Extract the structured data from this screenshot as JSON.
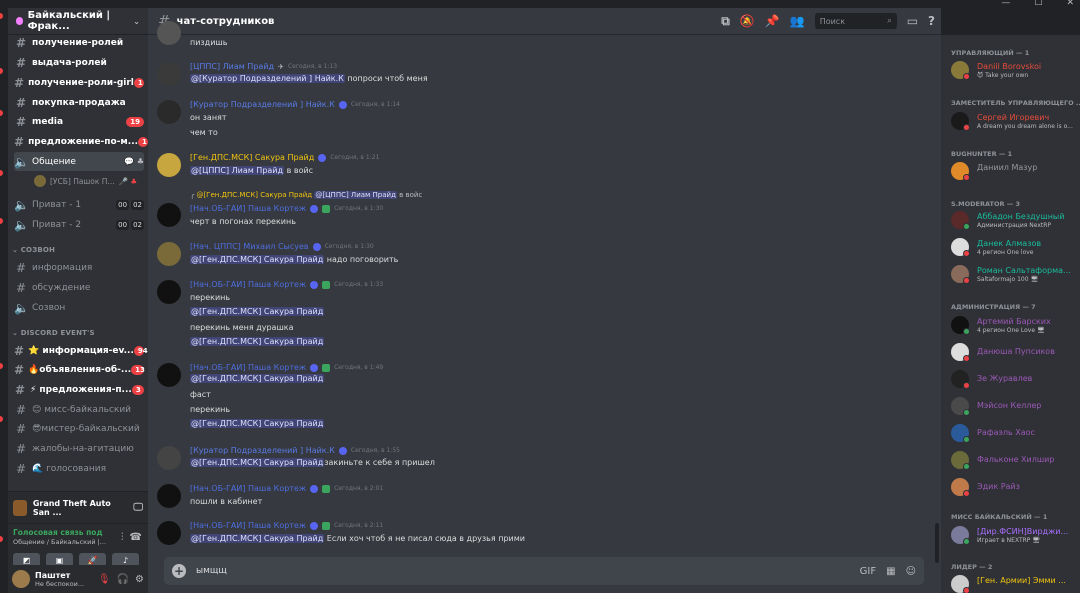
{
  "window": {
    "minimize": "—",
    "maximize": "☐",
    "close": "✕"
  },
  "server": {
    "name": "Байкальский | Фрак..."
  },
  "channels": [
    {
      "name": "получение-ролей",
      "unread": true,
      "badge": ""
    },
    {
      "name": "выдача-ролей",
      "unread": true,
      "badge": ""
    },
    {
      "name": "получение-роли-girl",
      "unread": true,
      "badge": "1"
    },
    {
      "name": "покупка-продажа",
      "unread": true,
      "badge": ""
    },
    {
      "name": "media",
      "unread": true,
      "badge": "19"
    },
    {
      "name": "предложение-по-м...",
      "unread": true,
      "badge": "1"
    }
  ],
  "voice_channels": [
    {
      "name": "Общение",
      "icons": "💬 ♣"
    },
    {
      "name": "Приват - 1",
      "c1": "00",
      "c2": "02"
    },
    {
      "name": "Приват - 2",
      "c1": "00",
      "c2": "02"
    }
  ],
  "voice_user": {
    "name": "[УСБ] Пашок П...",
    "icons": "🎤 ♣"
  },
  "category_1": "СОЗВОН",
  "channels_2": [
    {
      "name": "информация"
    },
    {
      "name": "обсуждение"
    }
  ],
  "voice_2": {
    "name": "Созвон"
  },
  "category_2": "DISCORD EVENT'S",
  "channels_3": [
    {
      "name": "⭐ информация-ev...",
      "badge": "94",
      "unread": true
    },
    {
      "name": "🔥объявления-об-...",
      "badge": "13",
      "unread": true
    },
    {
      "name": "⚡ предложения-п...",
      "badge": "3",
      "unread": true
    },
    {
      "name": "😊 мисс-байкальский",
      "badge": "",
      "unread": false
    },
    {
      "name": "😎мистер-байкальский",
      "badge": "",
      "unread": false
    },
    {
      "name": "жалобы-на-агитацию",
      "badge": "",
      "unread": false
    },
    {
      "name": "🌊 голосования",
      "badge": "",
      "unread": false
    }
  ],
  "activity": {
    "game": "Grand Theft Auto San ..."
  },
  "voice_status": {
    "title": "Голосовая связь под",
    "sub": "Общение / Байкальский |..."
  },
  "user": {
    "name": "Паштет",
    "status": "Не беспокои..."
  },
  "header": {
    "channel": "чат-сотрудников",
    "search_placeholder": "Поиск"
  },
  "messages": [
    {
      "lines": [
        "пиздишь"
      ]
    },
    {
      "author": "[ЦППС] Лиам Прайд",
      "time": "Сегодня, в 1:13",
      "mention": "@[Куратор Подразделений ] Найк.К",
      "text": "попроси чтоб меня"
    },
    {
      "author": "[Куратор Подразделений ] Найк.К",
      "time": "Сегодня, в 1:14",
      "lines": [
        "он занят",
        "чем то"
      ]
    },
    {
      "author": "[Ген.ДПС.МСК] Сакура Прайд",
      "time": "Сегодня, в 1:21",
      "mention": "@[ЦППС] Лиам Прайд",
      "text": "в войс"
    },
    {
      "reply": "@[Ген.ДПС.МСК] Сакура Прайд",
      "reply_mention": "@[ЦППС] Лиам Прайд",
      "reply_text": "в войс",
      "author": "[Нач.ОБ-ГАИ] Паша Кортеж",
      "time": "Сегодня, в 1:30",
      "lines": [
        "черт в погонах перекинь"
      ]
    },
    {
      "author": "[Нач. ЦППС] Михаил Сысуев",
      "time": "Сегодня, в 1:30",
      "mention": "@[Ген.ДПС.МСК] Сакура Прайд",
      "text": "надо поговорить"
    },
    {
      "author": "[Нач.ОБ-ГАИ] Паша Кортеж",
      "time": "Сегодня, в 1:33",
      "lines": [
        "перекинь",
        "@[Ген.ДПС.МСК] Сакура Прайд",
        "перекинь меня дурашка",
        "@[Ген.ДПС.МСК] Сакура Прайд"
      ]
    },
    {
      "author": "[Нач.ОБ-ГАИ] Паша Кортеж",
      "time": "Сегодня, в 1:49",
      "lines": [
        "@[Ген.ДПС.МСК] Сакура Прайд",
        "фаст",
        "перекинь",
        "@[Ген.ДПС.МСК] Сакура Прайд"
      ]
    },
    {
      "author": "[Куратор Подразделений ] Найк.К",
      "time": "Сегодня, в 1:55",
      "mention": "@[Ген.ДПС.МСК] Сакура Прайд",
      "text": "закиньте к себе я пришел"
    },
    {
      "author": "[Нач.ОБ-ГАИ] Паша Кортеж",
      "time": "Сегодня, в 2:01",
      "lines": [
        "пошли в кабинет"
      ]
    },
    {
      "author": "[Нач.ОБ-ГАИ] Паша Кортеж",
      "time": "Сегодня, в 2:11",
      "mention": "@[Ген.ДПС.МСК] Сакура Прайд",
      "text": "Если хоч чтоб я не писал сюда в друзья прими"
    }
  ],
  "composer": {
    "value": "ымщщ"
  },
  "members": {
    "cats": [
      "УПРАВЛЯЮЩИЙ — 1",
      "ЗАМЕСТИТЕЛЬ УПРАВЛЯЮЩЕГО ...",
      "BUGHUNTER — 1",
      "S.MODERATOR — 3",
      "АДМИНИСТРАЦИЯ — 7",
      "МИСС БАЙКАЛЬСКИЙ — 1",
      "ЛИДЕР — 2"
    ],
    "list": [
      {
        "name": "Daniil Borovskoi",
        "sub": "😈 Take your own",
        "color": "#e74c3c"
      },
      {
        "name": "Сергей Игоревич",
        "sub": "A dream you dream alone is o...",
        "color": "#e74c3c"
      },
      {
        "name": "Даниил Мазур",
        "sub": "",
        "color": "#96989d"
      },
      {
        "name": "Аббадон Бездушный",
        "sub": "Администрация NextRP",
        "color": "#1abc9c"
      },
      {
        "name": "Данек Алмазов",
        "sub": "4 регион One love",
        "color": "#1abc9c"
      },
      {
        "name": "Роман Сальтаформа...",
        "sub": "Saltaformajo 100 🖥",
        "color": "#1abc9c"
      },
      {
        "name": "Артемий Барских",
        "sub": "4 регион One Love 🖥",
        "color": "#9b59b6"
      },
      {
        "name": "Данюша Пупсиков",
        "sub": "",
        "color": "#9b59b6"
      },
      {
        "name": "Зе Журавлев",
        "sub": "",
        "color": "#9b59b6"
      },
      {
        "name": "Мэйсон Келлер",
        "sub": "",
        "color": "#9b59b6"
      },
      {
        "name": "Рафаэль Хаос",
        "sub": "",
        "color": "#9b59b6"
      },
      {
        "name": "Фальконе Хилшир",
        "sub": "",
        "color": "#9b59b6"
      },
      {
        "name": "Эдик Райз",
        "sub": "",
        "color": "#9b59b6"
      },
      {
        "name": "[Дир.ФСИН]Вирджи...",
        "sub": "Играет в NEXTRP 🖥",
        "color": "#a970ff"
      },
      {
        "name": "[Ген. Армии] Эмми ...",
        "sub": "",
        "color": "#f1c40f"
      }
    ]
  }
}
